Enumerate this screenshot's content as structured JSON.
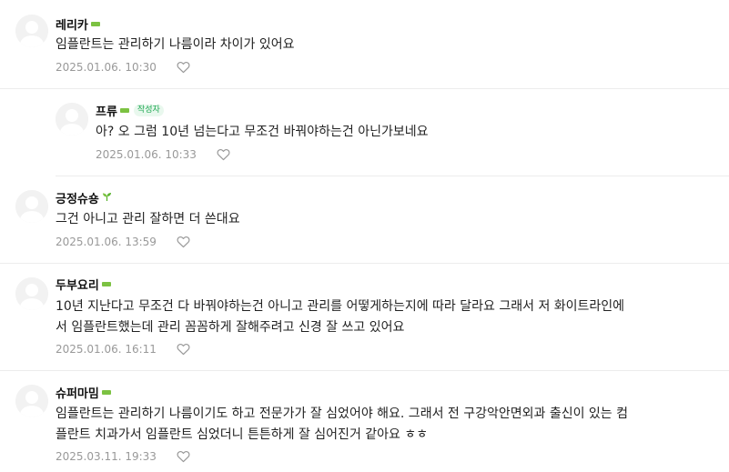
{
  "comments": [
    {
      "nickname": "레리카",
      "lines": [
        "임플란트는 관리하기 나름이라 차이가 있어요"
      ],
      "date": "2025.01.06. 10:30"
    },
    {
      "nickname": "프류",
      "author_badge": "작성자",
      "lines": [
        "아? 오 그럼 10년 넘는다고 무조건 바꿔야하는건 아닌가보네요"
      ],
      "date": "2025.01.06. 10:33"
    },
    {
      "nickname": "긍정슈숑",
      "lines": [
        "그건 아니고 관리 잘하면 더 쓴대요"
      ],
      "date": "2025.01.06. 13:59"
    },
    {
      "nickname": "두부요리",
      "lines": [
        "10년 지난다고 무조건 다 바꿔야하는건 아니고 관리를 어떻게하는지에 따라 달라요 그래서 저 화이트라인에",
        "서 임플란트했는데 관리 꼼꼼하게 잘해주려고 신경 잘 쓰고 있어요"
      ],
      "date": "2025.01.06. 16:11"
    },
    {
      "nickname": "슈퍼마밈",
      "lines": [
        "임플란트는 관리하기 나름이기도 하고 전문가가 잘 심었어야 해요. 그래서 전 구강악안면외과 출신이 있는 컴",
        "플란트 치과가서 임플란트 심었더니 튼튼하게 잘 심어진거 같아요 ㅎㅎ"
      ],
      "date": "2025.03.11. 19:33"
    }
  ],
  "icons": {
    "avatar": "default-profile-icon",
    "grade": "grade-bar-icon",
    "sprout": "sprout-icon",
    "like": "heart-outline-icon"
  },
  "colors": {
    "grade_green": "#7cc242",
    "author_badge_text": "#1fa853",
    "author_badge_bg": "#e9f8ee",
    "meta_gray": "#999999"
  }
}
